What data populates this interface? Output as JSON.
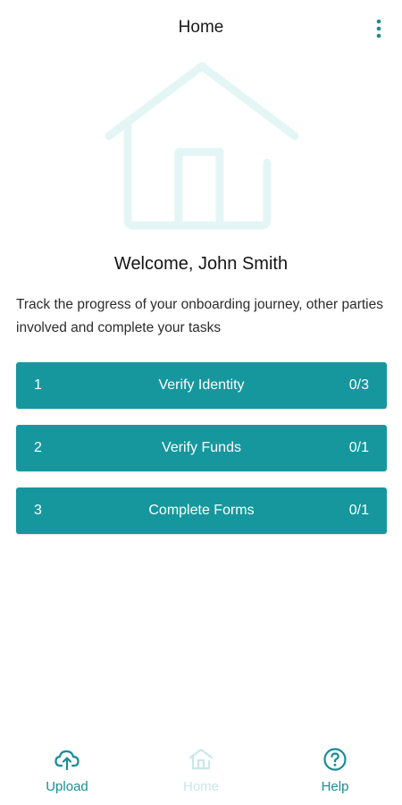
{
  "header": {
    "title": "Home",
    "menu_icon": "more-vertical-icon"
  },
  "hero": {
    "icon": "house-icon"
  },
  "welcome": {
    "title": "Welcome, John Smith",
    "subtitle": "Track the progress of your onboarding journey, other parties involved and complete your tasks"
  },
  "tasks": [
    {
      "number": "1",
      "label": "Verify Identity",
      "progress": "0/3"
    },
    {
      "number": "2",
      "label": "Verify Funds",
      "progress": "0/1"
    },
    {
      "number": "3",
      "label": "Complete Forms",
      "progress": "0/1"
    }
  ],
  "nav": [
    {
      "label": "Upload",
      "icon": "upload-cloud-icon",
      "state": "active"
    },
    {
      "label": "Home",
      "icon": "home-icon",
      "state": "current"
    },
    {
      "label": "Help",
      "icon": "help-circle-icon",
      "state": "active"
    }
  ],
  "colors": {
    "accent": "#16979e",
    "nav_active": "#1a8c94",
    "nav_muted": "#c9e7ea",
    "hero_outline": "#e4f5f5"
  }
}
